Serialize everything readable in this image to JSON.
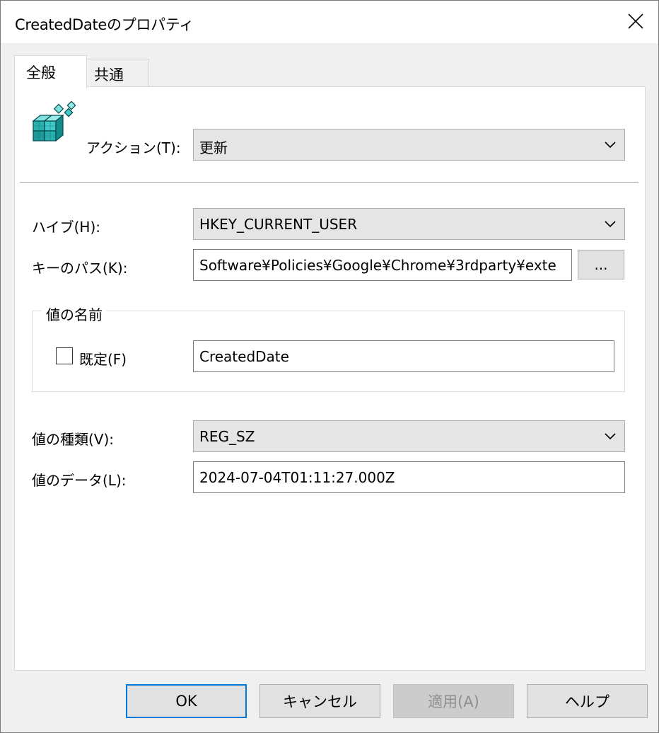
{
  "window": {
    "title": "CreatedDateのプロパティ"
  },
  "tabs": [
    {
      "label": "全般"
    },
    {
      "label": "共通"
    }
  ],
  "action": {
    "label": "アクション(T):",
    "value": "更新"
  },
  "hive": {
    "label": "ハイブ(H):",
    "value": "HKEY_CURRENT_USER"
  },
  "key_path": {
    "label": "キーのパス(K):",
    "value": "Software¥Policies¥Google¥Chrome¥3rdparty¥exte",
    "browse_label": "..."
  },
  "value_name": {
    "group_title": "値の名前",
    "default_checkbox_label": "既定(F)",
    "value": "CreatedDate"
  },
  "value_type": {
    "label": "値の種類(V):",
    "value": "REG_SZ"
  },
  "value_data": {
    "label": "値のデータ(L):",
    "value": "2024-07-04T01:11:27.000Z"
  },
  "buttons": {
    "ok": "OK",
    "cancel": "キャンセル",
    "apply": "適用(A)",
    "help": "ヘルプ"
  }
}
